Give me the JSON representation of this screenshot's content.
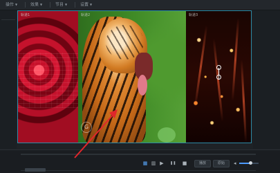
{
  "menu": {
    "items": [
      {
        "label": "操作"
      },
      {
        "label": "效果"
      },
      {
        "label": "节目"
      },
      {
        "label": "设置"
      }
    ]
  },
  "preview": {
    "panels": [
      {
        "label": "轨道1"
      },
      {
        "label": "轨道2"
      },
      {
        "label": "轨道3"
      }
    ],
    "watermark": "G"
  },
  "playback": {
    "fit_label": "适应",
    "play_label": "▶",
    "pause_label": "❚❚",
    "stop_label": "■",
    "pill_a": "播放",
    "pill_b": "原始",
    "volume_level": 0.6
  },
  "icons": {
    "annotation": "red-arrow-pointing"
  },
  "colors": {
    "accent": "#2c8ca8",
    "arrow": "#e0262b",
    "volume": "#4d9bff"
  }
}
